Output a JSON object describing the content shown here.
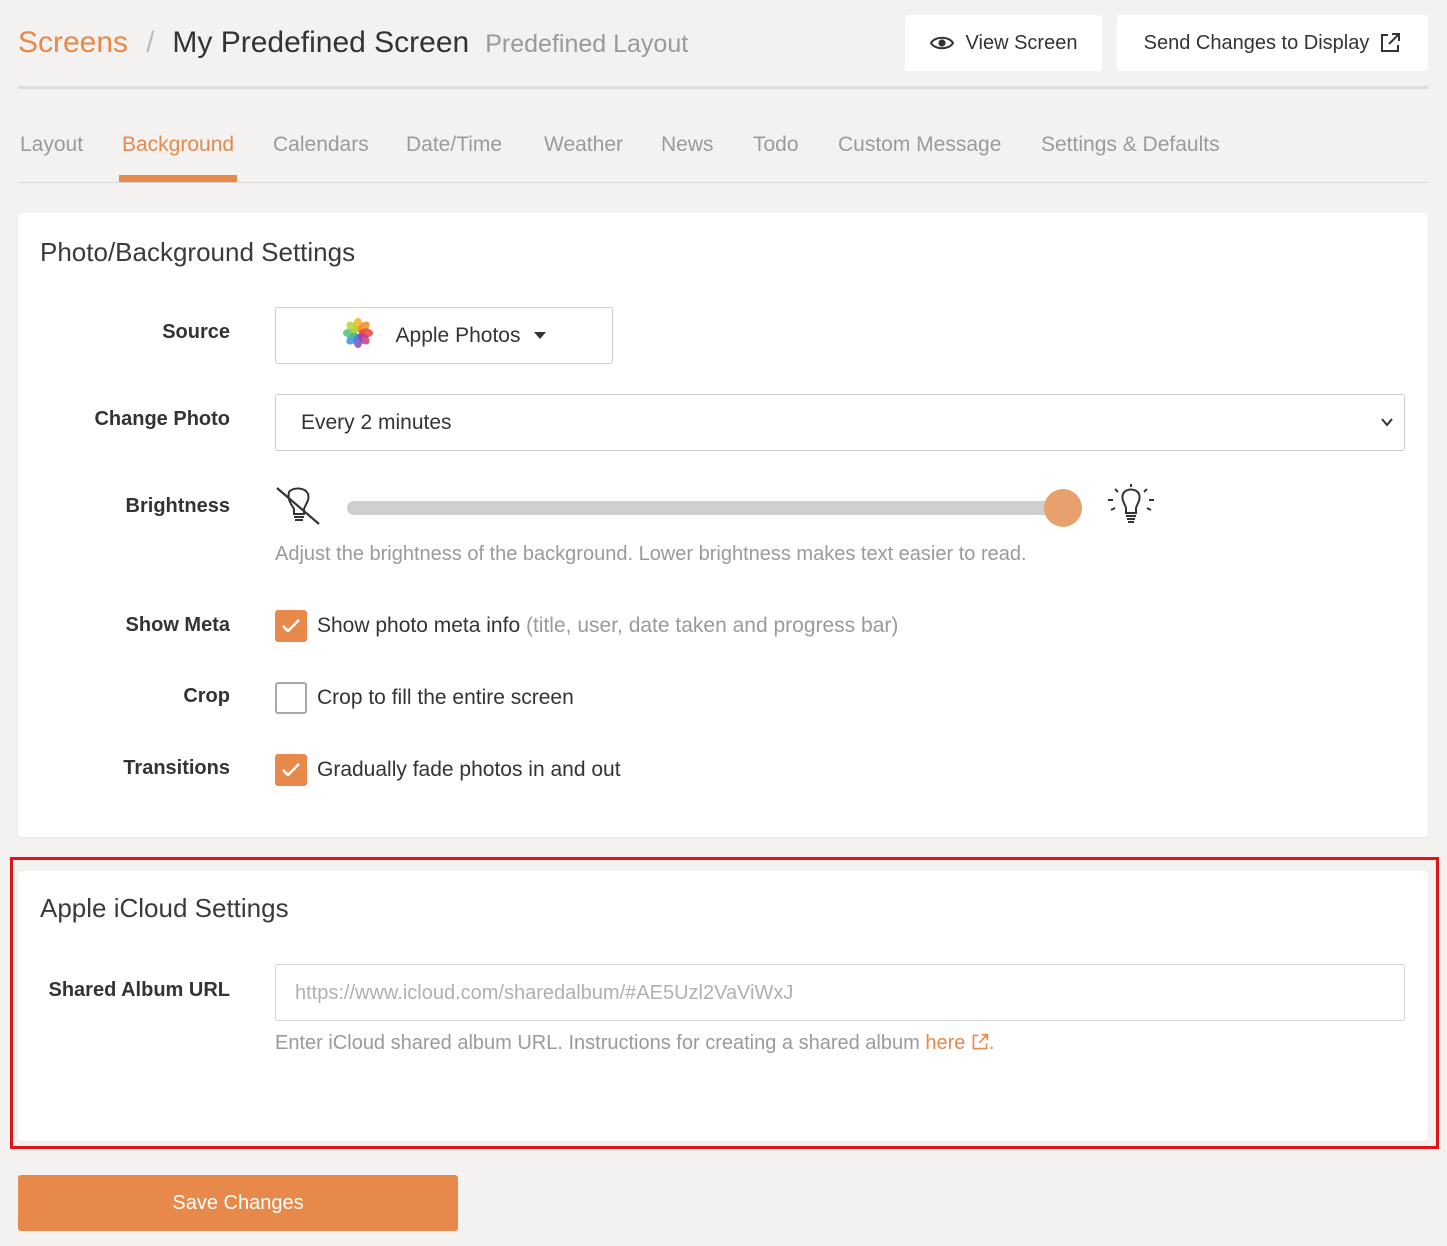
{
  "header": {
    "breadcrumb_root": "Screens",
    "breadcrumb_separator": "/",
    "screen_name": "My Predefined Screen",
    "layout_name": "Predefined Layout",
    "view_screen_label": "View Screen",
    "send_changes_label": "Send Changes to Display"
  },
  "tabs": [
    {
      "label": "Layout",
      "active": false
    },
    {
      "label": "Background",
      "active": true
    },
    {
      "label": "Calendars",
      "active": false
    },
    {
      "label": "Date/Time",
      "active": false
    },
    {
      "label": "Weather",
      "active": false
    },
    {
      "label": "News",
      "active": false
    },
    {
      "label": "Todo",
      "active": false
    },
    {
      "label": "Custom Message",
      "active": false
    },
    {
      "label": "Settings & Defaults",
      "active": false
    }
  ],
  "photo_settings": {
    "title": "Photo/Background Settings",
    "source": {
      "label": "Source",
      "value": "Apple Photos"
    },
    "change_photo": {
      "label": "Change Photo",
      "value": "Every 2 minutes"
    },
    "brightness": {
      "label": "Brightness",
      "value_fraction": 1.0,
      "help": "Adjust the brightness of the background. Lower brightness makes text easier to read."
    },
    "show_meta": {
      "label": "Show Meta",
      "checked": true,
      "text": "Show photo meta info",
      "note": "(title, user, date taken and progress bar)"
    },
    "crop": {
      "label": "Crop",
      "checked": false,
      "text": "Crop to fill the entire screen"
    },
    "transitions": {
      "label": "Transitions",
      "checked": true,
      "text": "Gradually fade photos in and out"
    }
  },
  "icloud_settings": {
    "title": "Apple iCloud Settings",
    "shared_album": {
      "label": "Shared Album URL",
      "placeholder": "https://www.icloud.com/sharedalbum/#AE5Uzl2VaViWxJ",
      "help_prefix": "Enter iCloud shared album URL. Instructions for creating a shared album ",
      "help_link": "here",
      "help_suffix": "."
    }
  },
  "footer": {
    "save_label": "Save Changes"
  },
  "colors": {
    "accent": "#e6894b",
    "page_background": "#f3f2f0",
    "highlight_frame": "#e0121a"
  }
}
